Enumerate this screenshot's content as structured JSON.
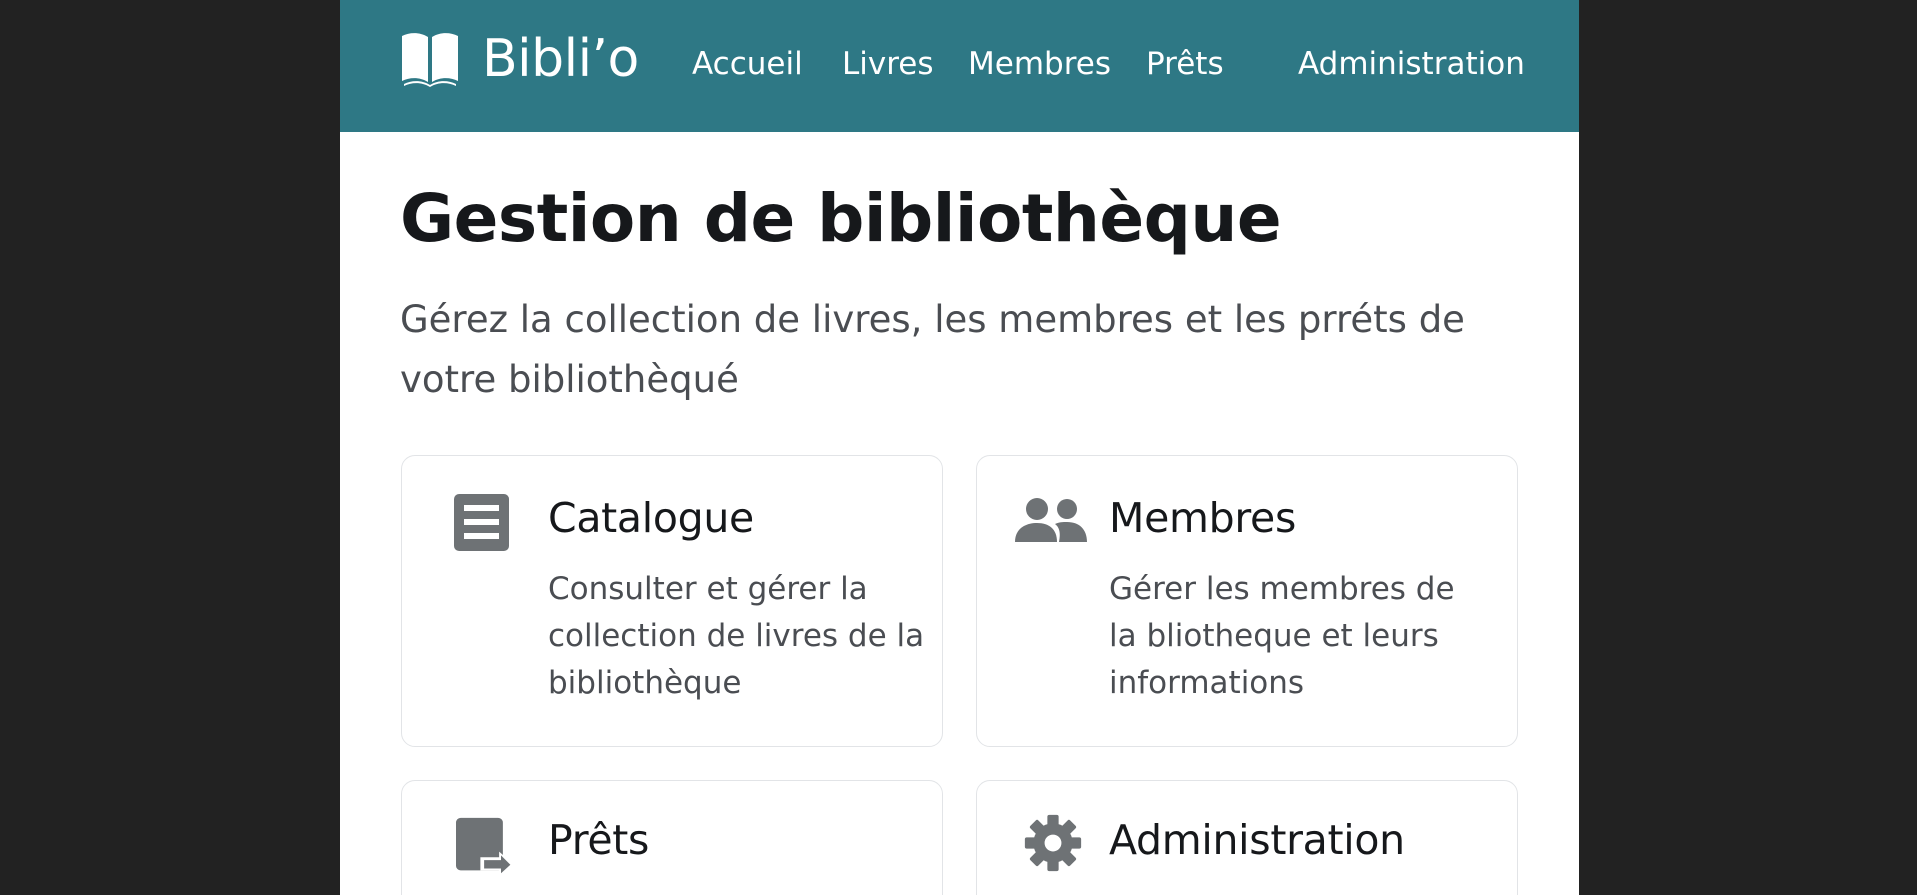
{
  "header": {
    "brand": "Bibli’o",
    "nav": [
      {
        "label": "Accueil"
      },
      {
        "label": "Livres"
      },
      {
        "label": "Membres"
      },
      {
        "label": "Prêts"
      },
      {
        "label": "Administration"
      }
    ]
  },
  "main": {
    "title": "Gestion de bibliothèque",
    "subtitle": "Gérez la collection de livres, les membres et les prréts de votre bibliothèqué"
  },
  "cards": [
    {
      "title": "Catalogue",
      "description": "Consulter et gérer la collection de livres de la bibliothèque",
      "icon": "catalogue-icon"
    },
    {
      "title": "Membres",
      "description": "Gérer les membres de la bliotheque et leurs informations",
      "icon": "members-icon"
    },
    {
      "title": "Prêts",
      "description": "",
      "icon": "loans-icon"
    },
    {
      "title": "Administration",
      "description": "",
      "icon": "gear-icon"
    }
  ],
  "colors": {
    "header": "#2e7885",
    "background": "#222222",
    "icon": "#6e7275"
  }
}
